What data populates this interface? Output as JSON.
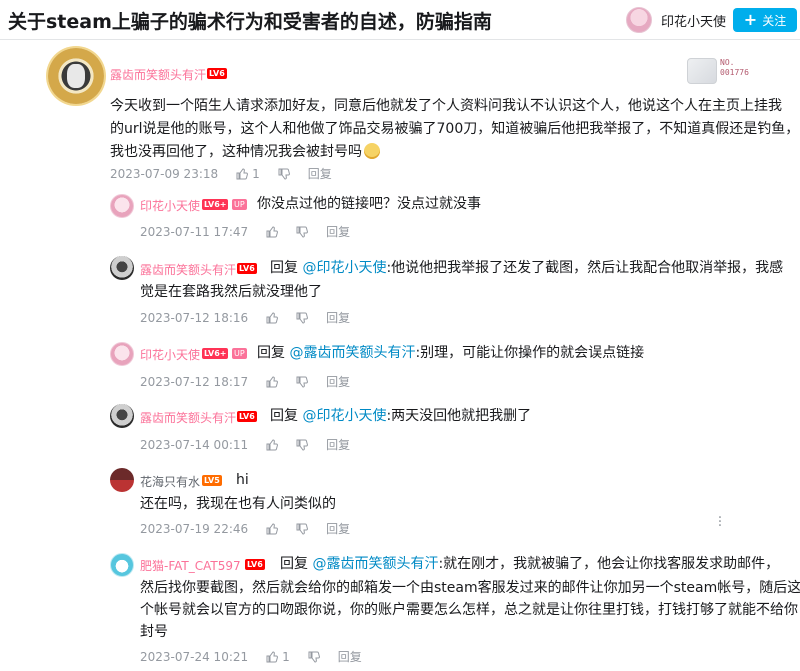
{
  "header": {
    "title": "关于steam上骗子的骗术行为和受害者的自述，防骗指南",
    "up_name": "印花小天使",
    "follow_label": "关注"
  },
  "main_comment": {
    "user": "露齿而笑额头有汗",
    "level": "LV6",
    "badge_no": "NO.\n001776",
    "lines": [
      "今天收到一个陌生人请求添加好友，同意后他就发了个人资料问我认不认识这个人，他说这个人在主页上挂我",
      "的url说是他的账号，这个人和他做了饰品交易被骗了700刀，知道被骗后他把我举报了，不知道真假还是钓鱼，",
      "我也没再回他了，这种情况我会被封号吗"
    ],
    "time": "2023-07-09 23:18",
    "likes": "1",
    "reply_label": "回复"
  },
  "replies": [
    {
      "user": "印花小天使",
      "level": "LV6+",
      "up": "UP",
      "prefix": "",
      "at": "",
      "text": "你没点过他的链接吧？没点过就没事",
      "time": "2023-07-11 17:47",
      "reply_label": "回复"
    },
    {
      "user": "露齿而笑额头有汗",
      "level": "LV6",
      "prefix": "回复 ",
      "at": "@印花小天使",
      "text": ":他说他把我举报了还发了截图，然后让我配合他取消举报，我感",
      "text2": "觉是在套路我然后就没理他了",
      "time": "2023-07-12 18:16",
      "reply_label": "回复"
    },
    {
      "user": "印花小天使",
      "level": "LV6+",
      "up": "UP",
      "prefix": "回复 ",
      "at": "@露齿而笑额头有汗",
      "text": ":别理，可能让你操作的就会误点链接",
      "time": "2023-07-12 18:17",
      "reply_label": "回复"
    },
    {
      "user": "露齿而笑额头有汗",
      "level": "LV6",
      "prefix": "回复 ",
      "at": "@印花小天使",
      "text": ":两天没回他就把我删了",
      "time": "2023-07-14 00:11",
      "reply_label": "回复"
    },
    {
      "user": "花海只有水",
      "level": "LV5",
      "prefix": "",
      "at": "",
      "text": "hi",
      "text2": "还在吗，我现在也有人问类似的",
      "time": "2023-07-19 22:46",
      "reply_label": "回复"
    },
    {
      "user": "肥猫-FAT_CAT597",
      "level": "LV6",
      "prefix": "回复 ",
      "at": "@露齿而笑额头有汗",
      "text": ":就在刚才，我就被骗了，他会让你找客服发求助邮件，",
      "text2": "然后找你要截图，然后就会给你的邮箱发一个由steam客服发过来的邮件让你加另一个steam帐号，随后这",
      "text3": "个帐号就会以官方的口吻跟你说，你的账户需要怎么怎样，总之就是让你往里打钱，打钱打够了就能不给你",
      "text4": "封号",
      "time": "2023-07-24 10:21",
      "likes": "1",
      "reply_label": "回复"
    }
  ]
}
